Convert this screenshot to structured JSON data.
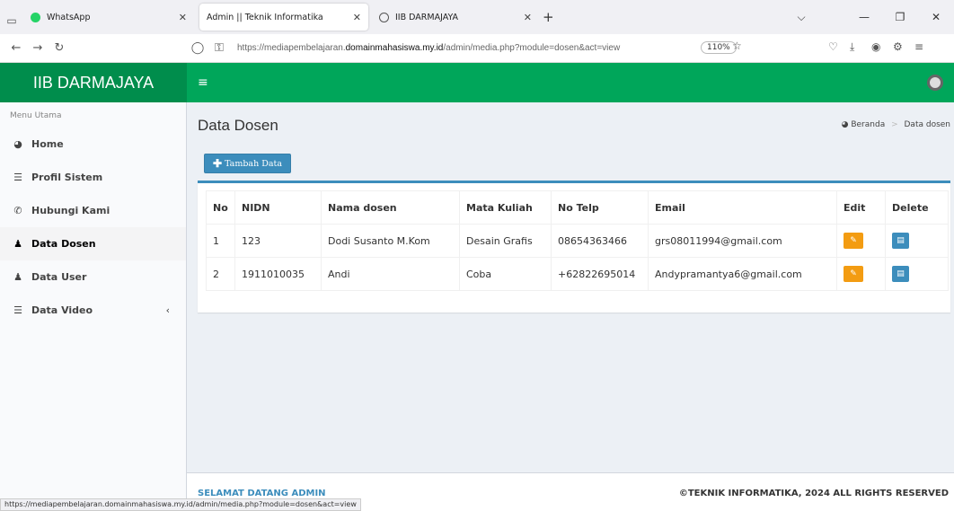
{
  "browser": {
    "tabs": [
      {
        "label": "WhatsApp"
      },
      {
        "label": "Admin || Teknik Informatika"
      },
      {
        "label": "IIB DARMAJAYA"
      }
    ],
    "url_prefix": "https://mediapembelajaran.",
    "url_domain": "domainmahasiswa.my.id",
    "url_suffix": "/admin/media.php?module=dosen&act=view",
    "zoom": "110%",
    "status_url": "https://mediapembelajaran.domainmahasiswa.my.id/admin/media.php?module=dosen&act=view"
  },
  "header": {
    "brand": "IIB DARMAJAYA"
  },
  "sidebar": {
    "menu_header": "Menu Utama",
    "items": [
      {
        "label": "Home",
        "icon": "dashboard-icon"
      },
      {
        "label": "Profil Sistem",
        "icon": "list-icon"
      },
      {
        "label": "Hubungi Kami",
        "icon": "phone-icon"
      },
      {
        "label": "Data Dosen",
        "icon": "user-icon"
      },
      {
        "label": "Data User",
        "icon": "users-icon"
      },
      {
        "label": "Data Video",
        "icon": "database-icon"
      }
    ]
  },
  "main": {
    "title": "Data Dosen",
    "breadcrumb": {
      "home": "Beranda",
      "current": "Data dosen"
    },
    "add_button": "Tambah Data",
    "table": {
      "headers": [
        "No",
        "NIDN",
        "Nama dosen",
        "Mata Kuliah",
        "No Telp",
        "Email",
        "Edit",
        "Delete"
      ],
      "rows": [
        {
          "no": "1",
          "nidn": "123",
          "nama": "Dodi Susanto M.Kom",
          "matkul": "Desain Grafis",
          "telp": "08654363466",
          "email": "grs08011994@gmail.com"
        },
        {
          "no": "2",
          "nidn": "1911010035",
          "nama": "Andi",
          "matkul": "Coba",
          "telp": "+62822695014",
          "email": "Andypramantya6@gmail.com"
        }
      ]
    }
  },
  "footer": {
    "left": "SELAMAT DATANG ADMIN",
    "right": "©TEKNIK INFORMATIKA, 2024 ALL RIGHTS RESERVED"
  },
  "colors": {
    "header": "#00a65a",
    "primary": "#3c8dbc",
    "warning": "#f39c12"
  }
}
